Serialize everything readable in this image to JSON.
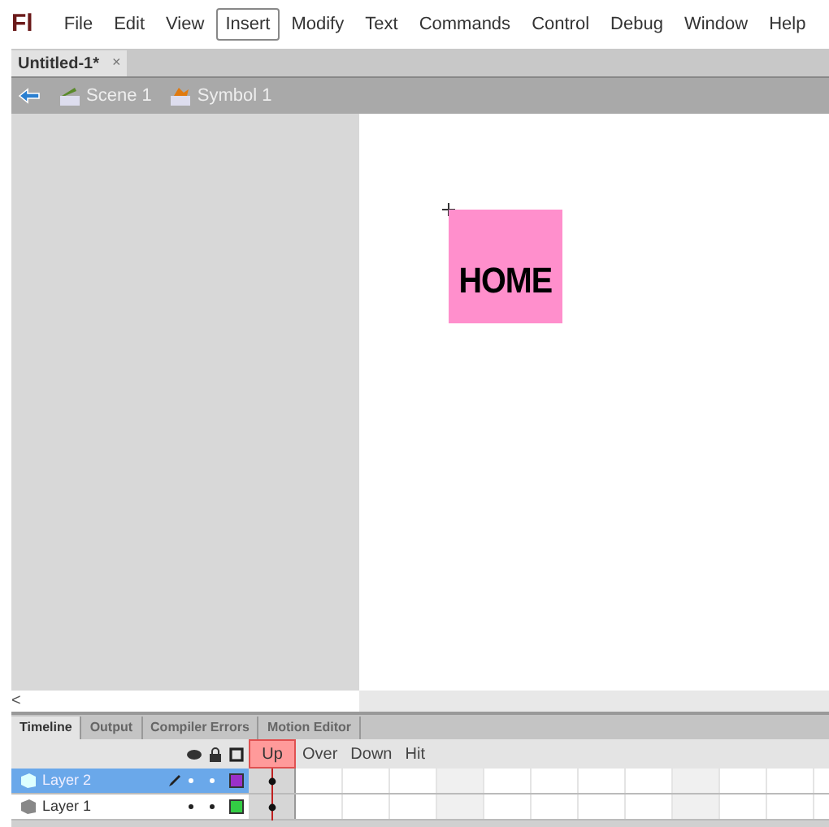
{
  "menu_bar": {
    "logo": "Fl",
    "items": [
      {
        "label": "File",
        "selected": false
      },
      {
        "label": "Edit",
        "selected": false
      },
      {
        "label": "View",
        "selected": false
      },
      {
        "label": "Insert",
        "selected": true
      },
      {
        "label": "Modify",
        "selected": false
      },
      {
        "label": "Text",
        "selected": false
      },
      {
        "label": "Commands",
        "selected": false
      },
      {
        "label": "Control",
        "selected": false
      },
      {
        "label": "Debug",
        "selected": false
      },
      {
        "label": "Window",
        "selected": false
      },
      {
        "label": "Help",
        "selected": false
      }
    ]
  },
  "document_tab": {
    "title": "Untitled-1*",
    "close": "×"
  },
  "breadcrumb": [
    {
      "kind": "scene",
      "label": "Scene 1"
    },
    {
      "kind": "symbol",
      "label": "Symbol 1"
    }
  ],
  "stage": {
    "symbol_label": "HOME",
    "scroll_arrow": "<"
  },
  "panel_tabs": [
    {
      "label": "Timeline",
      "selected": true
    },
    {
      "label": "Output",
      "selected": false
    },
    {
      "label": "Compiler Errors",
      "selected": false
    },
    {
      "label": "Motion Editor",
      "selected": false
    }
  ],
  "frame_labels": [
    {
      "label": "Up",
      "selected": true
    },
    {
      "label": "Over",
      "selected": false
    },
    {
      "label": "Down",
      "selected": false
    },
    {
      "label": "Hit",
      "selected": false
    }
  ],
  "layers": [
    {
      "name": "Layer 2",
      "selected": true,
      "editing": true,
      "color": "#9b30c8"
    },
    {
      "name": "Layer 1",
      "selected": false,
      "editing": false,
      "color": "#33cc44"
    }
  ]
}
